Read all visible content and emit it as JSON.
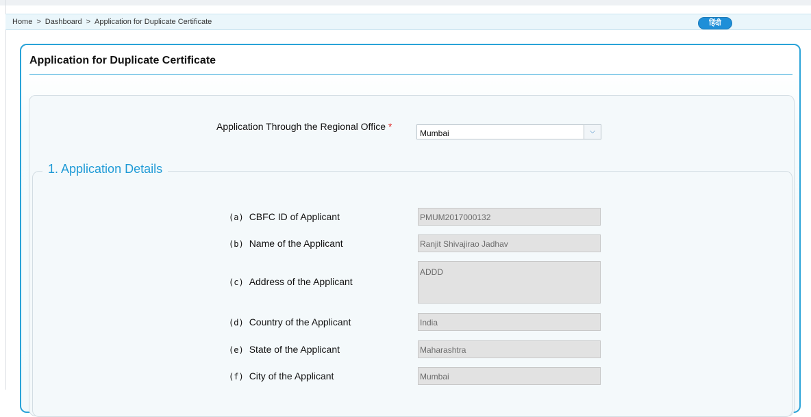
{
  "breadcrumb": {
    "items": [
      "Home",
      "Dashboard",
      "Application for Duplicate Certificate"
    ],
    "separator": ">"
  },
  "language_button": {
    "label": "हिंदी"
  },
  "page": {
    "title": "Application for Duplicate Certificate"
  },
  "regional_office": {
    "label": "Application Through the Regional Office",
    "required_marker": "*",
    "selected": "Mumbai",
    "arrow_icon": "chevron-down-icon"
  },
  "section": {
    "legend": "1. Application Details",
    "rows": [
      {
        "index": "(a)",
        "label": "CBFC ID of Applicant",
        "value": "PMUM2017000132"
      },
      {
        "index": "(b)",
        "label": "Name of the Applicant",
        "value": "Ranjit Shivajirao Jadhav"
      },
      {
        "index": "(c)",
        "label": "Address of the Applicant",
        "value": "ADDD"
      },
      {
        "index": "(d)",
        "label": "Country of the Applicant",
        "value": "India"
      },
      {
        "index": "(e)",
        "label": "State of the Applicant",
        "value": "Maharashtra"
      },
      {
        "index": "(f)",
        "label": "City of the Applicant",
        "value": "Mumbai"
      }
    ]
  },
  "colors": {
    "accent": "#1e9ad6",
    "border": "#2aa3d8",
    "button": "#1f8fd8",
    "readonly_field": "#e2e2e2",
    "required": "#dd2222"
  }
}
